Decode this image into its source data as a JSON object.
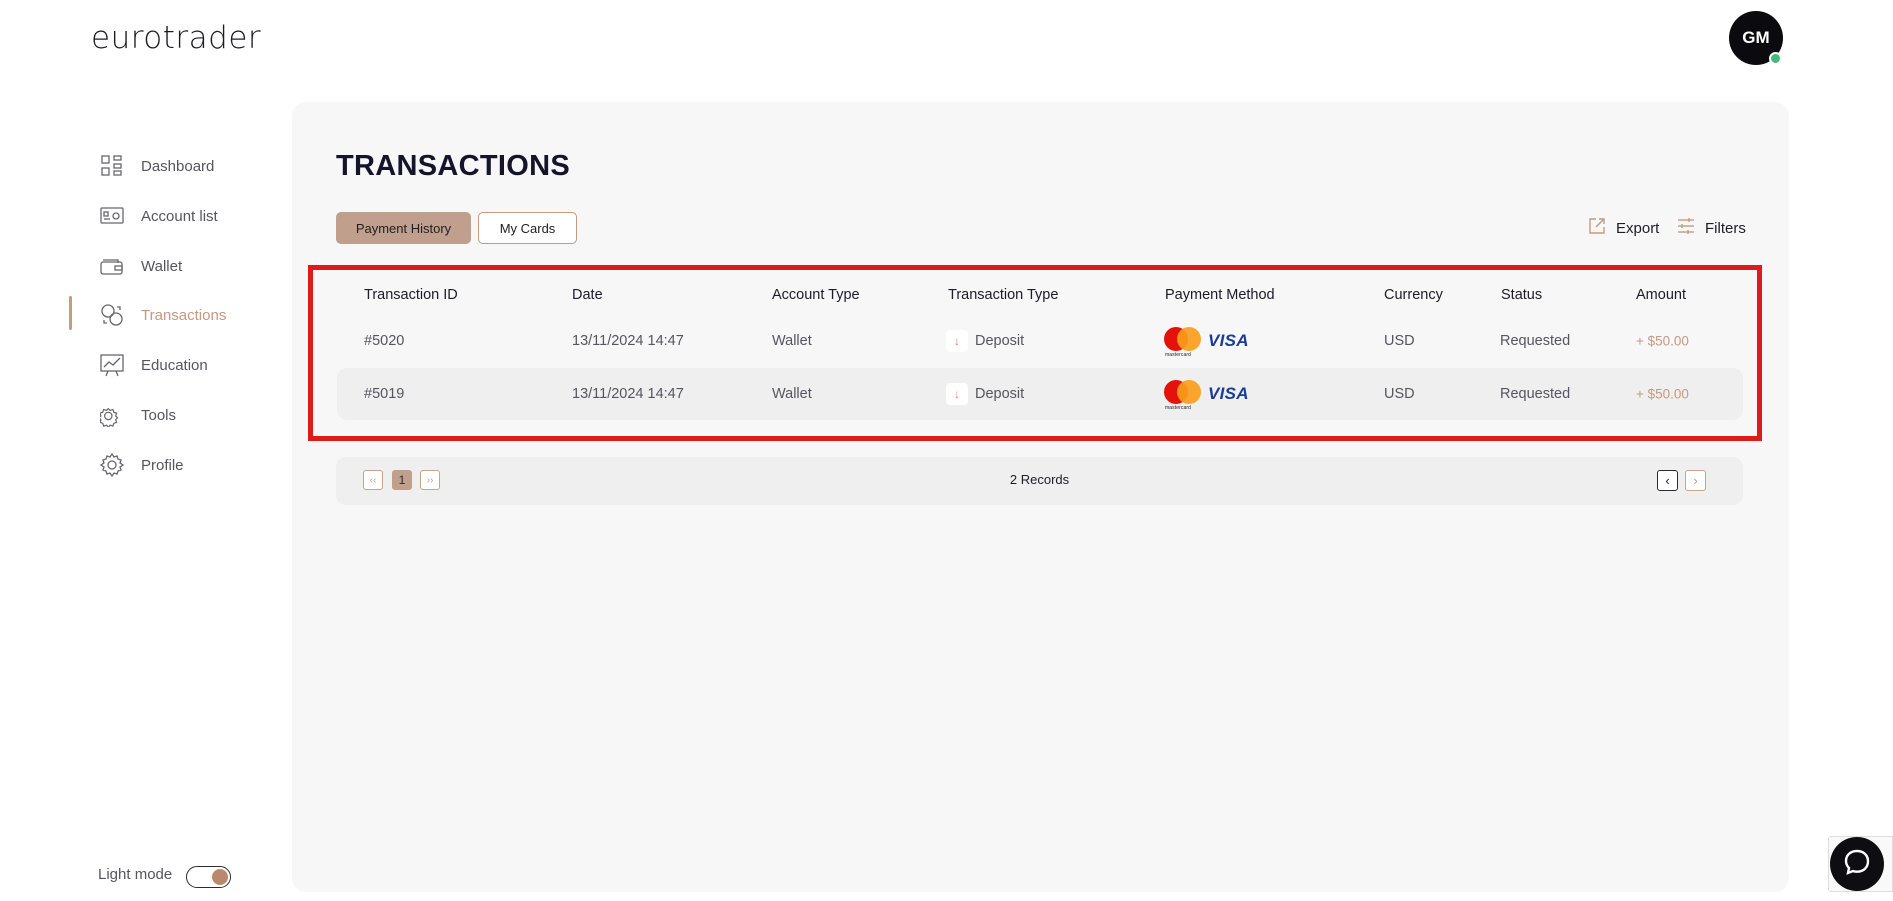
{
  "header": {
    "logo": "eurotrader",
    "avatar_initials": "GM",
    "status_color": "#45b97c"
  },
  "sidebar": {
    "items": [
      {
        "label": "Dashboard",
        "icon": "grid-icon"
      },
      {
        "label": "Account list",
        "icon": "account-card-icon"
      },
      {
        "label": "Wallet",
        "icon": "wallet-icon"
      },
      {
        "label": "Transactions",
        "icon": "transactions-icon",
        "active": true
      },
      {
        "label": "Education",
        "icon": "chart-board-icon"
      },
      {
        "label": "Tools",
        "icon": "gear-cluster-icon"
      },
      {
        "label": "Profile",
        "icon": "gear-icon"
      }
    ],
    "light_mode_label": "Light mode",
    "light_mode_on": true
  },
  "main": {
    "title": "TRANSACTIONS",
    "tabs": [
      {
        "label": "Payment History",
        "active": true
      },
      {
        "label": "My Cards",
        "active": false
      }
    ],
    "export_label": "Export",
    "filters_label": "Filters",
    "table": {
      "columns": [
        "Transaction ID",
        "Date",
        "Account Type",
        "Transaction Type",
        "Payment Method",
        "Currency",
        "Status",
        "Amount"
      ],
      "rows": [
        {
          "id": "#5020",
          "date": "13/11/2024 14:47",
          "account_type": "Wallet",
          "transaction_type": "Deposit",
          "payment_method": "mastercard",
          "visa": "VISA",
          "currency": "USD",
          "status": "Requested",
          "amount": "+ $50.00"
        },
        {
          "id": "#5019",
          "date": "13/11/2024 14:47",
          "account_type": "Wallet",
          "transaction_type": "Deposit",
          "payment_method": "mastercard",
          "visa": "VISA",
          "currency": "USD",
          "status": "Requested",
          "amount": "+ $50.00"
        }
      ]
    },
    "pagination": {
      "first": "‹‹",
      "current_page": "1",
      "last": "››",
      "records": "2 Records",
      "prev": "‹",
      "next": "›"
    }
  },
  "colors": {
    "accent": "#c49a80",
    "highlight": "#e01919"
  }
}
